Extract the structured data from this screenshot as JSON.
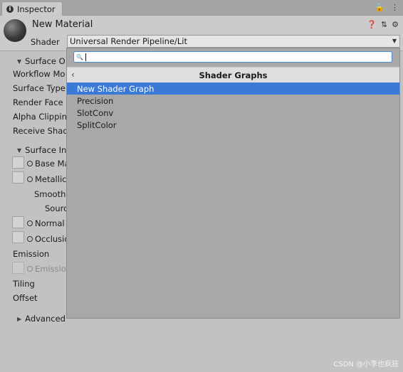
{
  "tab": {
    "label": "Inspector",
    "icon": "info-icon"
  },
  "tab_tools": [
    {
      "icon": "lock-icon",
      "glyph": "🔒"
    },
    {
      "icon": "more-icon",
      "glyph": "⋮"
    }
  ],
  "material": {
    "name": "New Material"
  },
  "header_icons": [
    {
      "icon": "help-icon",
      "glyph": "❓"
    },
    {
      "icon": "sliders-icon",
      "glyph": "⇅"
    },
    {
      "icon": "gear-icon",
      "glyph": "⚙"
    }
  ],
  "shader": {
    "label": "Shader",
    "value": "Universal Render Pipeline/Lit"
  },
  "surface_options": {
    "title": "Surface O",
    "rows": [
      "Workflow Mo",
      "Surface Type",
      "Render Face",
      "Alpha Clippin",
      "Receive Shad"
    ]
  },
  "surface_inputs": {
    "title": "Surface In",
    "base_map": "Base Ma",
    "metallic": "Metallic",
    "smooth": "Smooth",
    "source": "Sourc",
    "normal": "Normal",
    "occlusion": "Occlusic",
    "emission_label": "Emission",
    "emission_map": "Emission",
    "tiling": "Tiling",
    "offset": "Offset"
  },
  "advanced": {
    "title": "Advanced"
  },
  "popup": {
    "search": {
      "value": ""
    },
    "title": "Shader Graphs",
    "items": [
      "New Shader Graph",
      "Precision",
      "SlotConv",
      "SplitColor"
    ],
    "selected_index": 0
  },
  "watermark": "CSDN @小李也疯狂"
}
